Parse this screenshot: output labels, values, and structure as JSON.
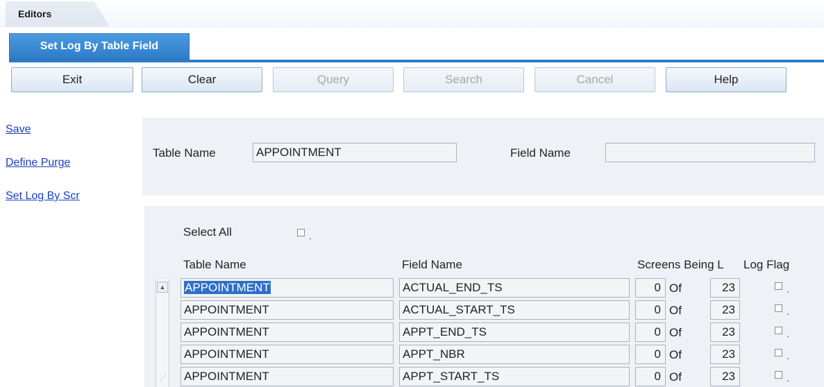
{
  "app": {
    "editors_tab": "Editors",
    "active_tab": "Set Log By Table Field"
  },
  "toolbar": {
    "exit": "Exit",
    "clear": "Clear",
    "query": "Query",
    "search": "Search",
    "cancel": "Cancel",
    "help": "Help"
  },
  "sidebar": {
    "save": "Save",
    "define_purge": "Define Purge",
    "set_log_by_scr": "Set Log By Scr"
  },
  "header_form": {
    "table_name_label": "Table Name",
    "table_name_value": "APPOINTMENT",
    "field_name_label": "Field Name",
    "field_name_value": ""
  },
  "grid": {
    "select_all_label": "Select All",
    "columns": {
      "table_name": "Table Name",
      "field_name": "Field Name",
      "screens": "Screens Being L",
      "log_flag": "Log Flag"
    },
    "rows": [
      {
        "table": "APPOINTMENT",
        "field": "ACTUAL_END_TS",
        "count": "0",
        "of": "Of",
        "total": "23"
      },
      {
        "table": "APPOINTMENT",
        "field": "ACTUAL_START_TS",
        "count": "0",
        "of": "Of",
        "total": "23"
      },
      {
        "table": "APPOINTMENT",
        "field": "APPT_END_TS",
        "count": "0",
        "of": "Of",
        "total": "23"
      },
      {
        "table": "APPOINTMENT",
        "field": "APPT_NBR",
        "count": "0",
        "of": "Of",
        "total": "23"
      },
      {
        "table": "APPOINTMENT",
        "field": "APPT_START_TS",
        "count": "0",
        "of": "Of",
        "total": "23"
      }
    ]
  },
  "icons": {
    "scroll_up": "scroll-up-arrow-icon",
    "grip": "resize-grip-icon",
    "checkbox": "checkbox-icon"
  }
}
